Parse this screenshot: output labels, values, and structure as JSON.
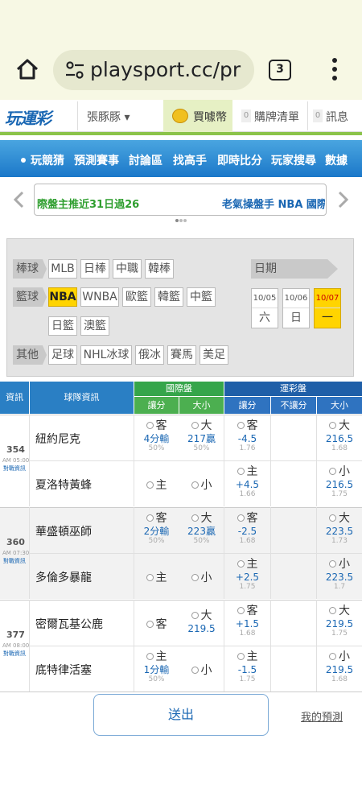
{
  "browser": {
    "url": "playsport.cc/pr",
    "tab_count": "3"
  },
  "header": {
    "logo": "玩運彩",
    "user": "張豚豚 ▾",
    "coin": "買噱幣",
    "cart_badge": "0",
    "cart": "購牌清單",
    "msg_badge": "0",
    "msg": "訊息"
  },
  "nav": [
    "玩競猜",
    "預測賽事",
    "討論區",
    "找高手",
    "即時比分",
    "玩家搜尋",
    "數據"
  ],
  "banner": {
    "left": "際盤主推近31日過26",
    "right": "老氣操盤手 NBA 國際"
  },
  "filter": {
    "baseball_label": "棒球",
    "baseball": [
      "MLB",
      "日棒",
      "中職",
      "韓棒"
    ],
    "basketball_label": "籃球",
    "basketball": [
      "NBA",
      "WNBA",
      "歐籃",
      "韓籃",
      "中籃"
    ],
    "basketball2": [
      "日籃",
      "澳籃"
    ],
    "other_label": "其他",
    "other": [
      "足球",
      "NHL冰球",
      "俄冰",
      "賽馬",
      "美足"
    ],
    "date_label": "日期",
    "dates": [
      {
        "d": "10/05",
        "w": "六"
      },
      {
        "d": "10/06",
        "w": "日"
      },
      {
        "d": "10/07",
        "w": "一"
      }
    ]
  },
  "table": {
    "h_info": "資訊",
    "h_team": "球隊資訊",
    "h_intl": "國際盤",
    "h_sport": "運彩盤",
    "h_spread": "讓分",
    "h_total": "大小",
    "h_sspread": "讓分",
    "h_nospread": "不讓分",
    "h_stotal": "大小",
    "games": [
      {
        "num": "354",
        "time": "AM 05:00",
        "vs": "對戰資訊",
        "away": {
          "team": "紐約尼克",
          "is": "客",
          "isv": "4分輸",
          "isp": "50%",
          "it": "大",
          "itv": "217贏",
          "itp": "50%",
          "ss": "客",
          "ssv": "-4.5",
          "ssp": "1.76",
          "st": "大",
          "stv": "216.5",
          "stp": "1.68"
        },
        "home": {
          "team": "夏洛特黃蜂",
          "is": "主",
          "it": "小",
          "ss": "主",
          "ssv": "+4.5",
          "ssp": "1.66",
          "st": "小",
          "stv": "216.5",
          "stp": "1.75"
        }
      },
      {
        "num": "360",
        "time": "AM 07:30",
        "vs": "對戰資訊",
        "away": {
          "team": "華盛頓巫師",
          "is": "客",
          "isv": "2分輸",
          "isp": "50%",
          "it": "大",
          "itv": "223贏",
          "itp": "50%",
          "ss": "客",
          "ssv": "-2.5",
          "ssp": "1.68",
          "st": "大",
          "stv": "223.5",
          "stp": "1.73"
        },
        "home": {
          "team": "多倫多暴龍",
          "is": "主",
          "it": "小",
          "ss": "主",
          "ssv": "+2.5",
          "ssp": "1.75",
          "st": "小",
          "stv": "223.5",
          "stp": "1.7"
        }
      },
      {
        "num": "377",
        "time": "AM 08:00",
        "vs": "對戰資訊",
        "away": {
          "team": "密爾瓦基公鹿",
          "is": "客",
          "it": "大",
          "itv": "219.5",
          "ss": "客",
          "ssv": "+1.5",
          "ssp": "1.68",
          "st": "大",
          "stv": "219.5",
          "stp": "1.75"
        },
        "home": {
          "team": "底特律活塞",
          "is": "主",
          "isv": "1分輸",
          "isp": "50%",
          "it": "小",
          "ss": "主",
          "ssv": "-1.5",
          "ssp": "1.75",
          "st": "小",
          "stv": "219.5",
          "stp": "1.68"
        }
      }
    ]
  },
  "footer": {
    "submit": "送出",
    "my_predictions": "我的預測"
  }
}
